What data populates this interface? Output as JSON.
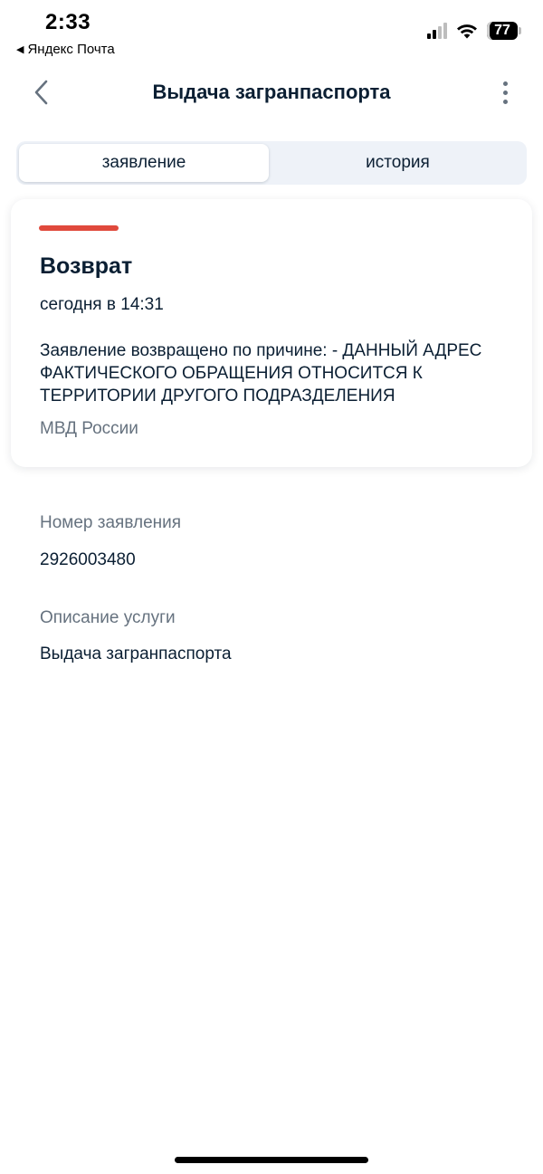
{
  "status_bar": {
    "time": "2:33",
    "back_app": "Яндекс Почта",
    "battery": "77"
  },
  "header": {
    "title": "Выдача загранпаспорта"
  },
  "tabs": [
    {
      "label": "заявление",
      "active": true
    },
    {
      "label": "история",
      "active": false
    }
  ],
  "status_card": {
    "accent_color": "#e0493c",
    "title": "Возврат",
    "time": "сегодня в 14:31",
    "message": "Заявление возвращено по причине: - ДАННЫЙ АДРЕС ФАКТИЧЕСКОГО ОБРАЩЕНИЯ ОТНОСИТСЯ К ТЕРРИТОРИИ ДРУГОГО ПОДРАЗДЕЛЕНИЯ",
    "organization": "МВД России"
  },
  "fields": [
    {
      "label": "Номер заявления",
      "value": "2926003480"
    },
    {
      "label": "Описание услуги",
      "value": "Выдача загранпаспорта"
    }
  ]
}
